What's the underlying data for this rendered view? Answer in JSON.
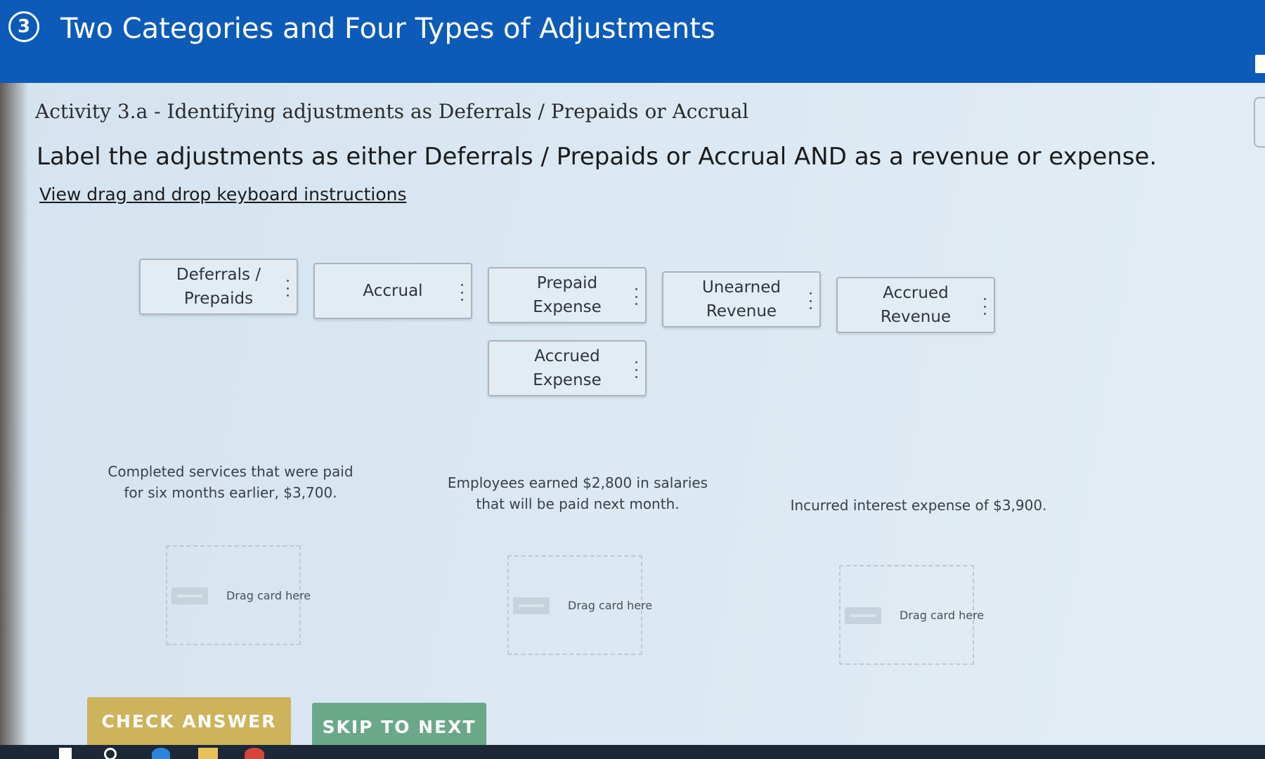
{
  "header": {
    "step_number": "3",
    "title": "Two Categories and Four Types of Adjustments"
  },
  "activity": {
    "title": "Activity 3.a - Identifying adjustments as Deferrals / Prepaids or Accrual",
    "instructions": "Label the adjustments as either Deferrals / Prepaids or Accrual AND as a revenue or expense.",
    "keyboard_link": "View drag and drop keyboard instructions"
  },
  "cards": [
    {
      "label": "Deferrals / Prepaids"
    },
    {
      "label": "Accrual"
    },
    {
      "label": "Prepaid Expense"
    },
    {
      "label": "Unearned Revenue"
    },
    {
      "label": "Accrued Revenue"
    },
    {
      "label": "Accrued Expense"
    }
  ],
  "prompts": [
    {
      "text": "Completed services that were paid for six months earlier, $3,700.",
      "dropzone_label": "Drag card here"
    },
    {
      "text": "Employees earned $2,800 in salaries that will be paid next month.",
      "dropzone_label": "Drag card here"
    },
    {
      "text": "Incurred interest expense of $3,900.",
      "dropzone_label": "Drag card here"
    }
  ],
  "buttons": {
    "check": "CHECK ANSWER",
    "skip": "SKIP TO NEXT"
  }
}
